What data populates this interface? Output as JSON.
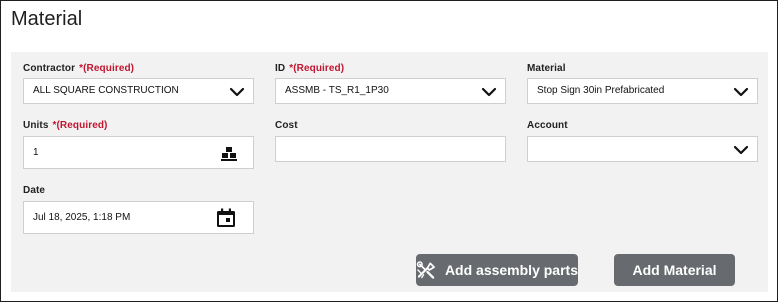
{
  "page": {
    "title": "Material"
  },
  "form": {
    "required_text": "*(Required)",
    "contractor": {
      "label": "Contractor",
      "value": "ALL SQUARE CONSTRUCTION"
    },
    "id": {
      "label": "ID",
      "value": "ASSMB - TS_R1_1P30"
    },
    "material": {
      "label": "Material",
      "value": "Stop Sign 30in Prefabricated"
    },
    "units": {
      "label": "Units",
      "value": "1"
    },
    "cost": {
      "label": "Cost",
      "value": ""
    },
    "account": {
      "label": "Account",
      "value": ""
    },
    "date": {
      "label": "Date",
      "value": "Jul 18, 2025, 1:18 PM"
    }
  },
  "actions": {
    "add_assembly_parts": "Add assembly parts",
    "add_material": "Add Material"
  },
  "icons": {
    "dropdown": "chevron-down-icon",
    "units": "stacked-boxes-icon",
    "date": "calendar-icon",
    "assembly": "tools-icon"
  },
  "colors": {
    "required": "#c0152f",
    "button_bg": "#676a6e",
    "panel_bg": "#f2f2f2"
  }
}
